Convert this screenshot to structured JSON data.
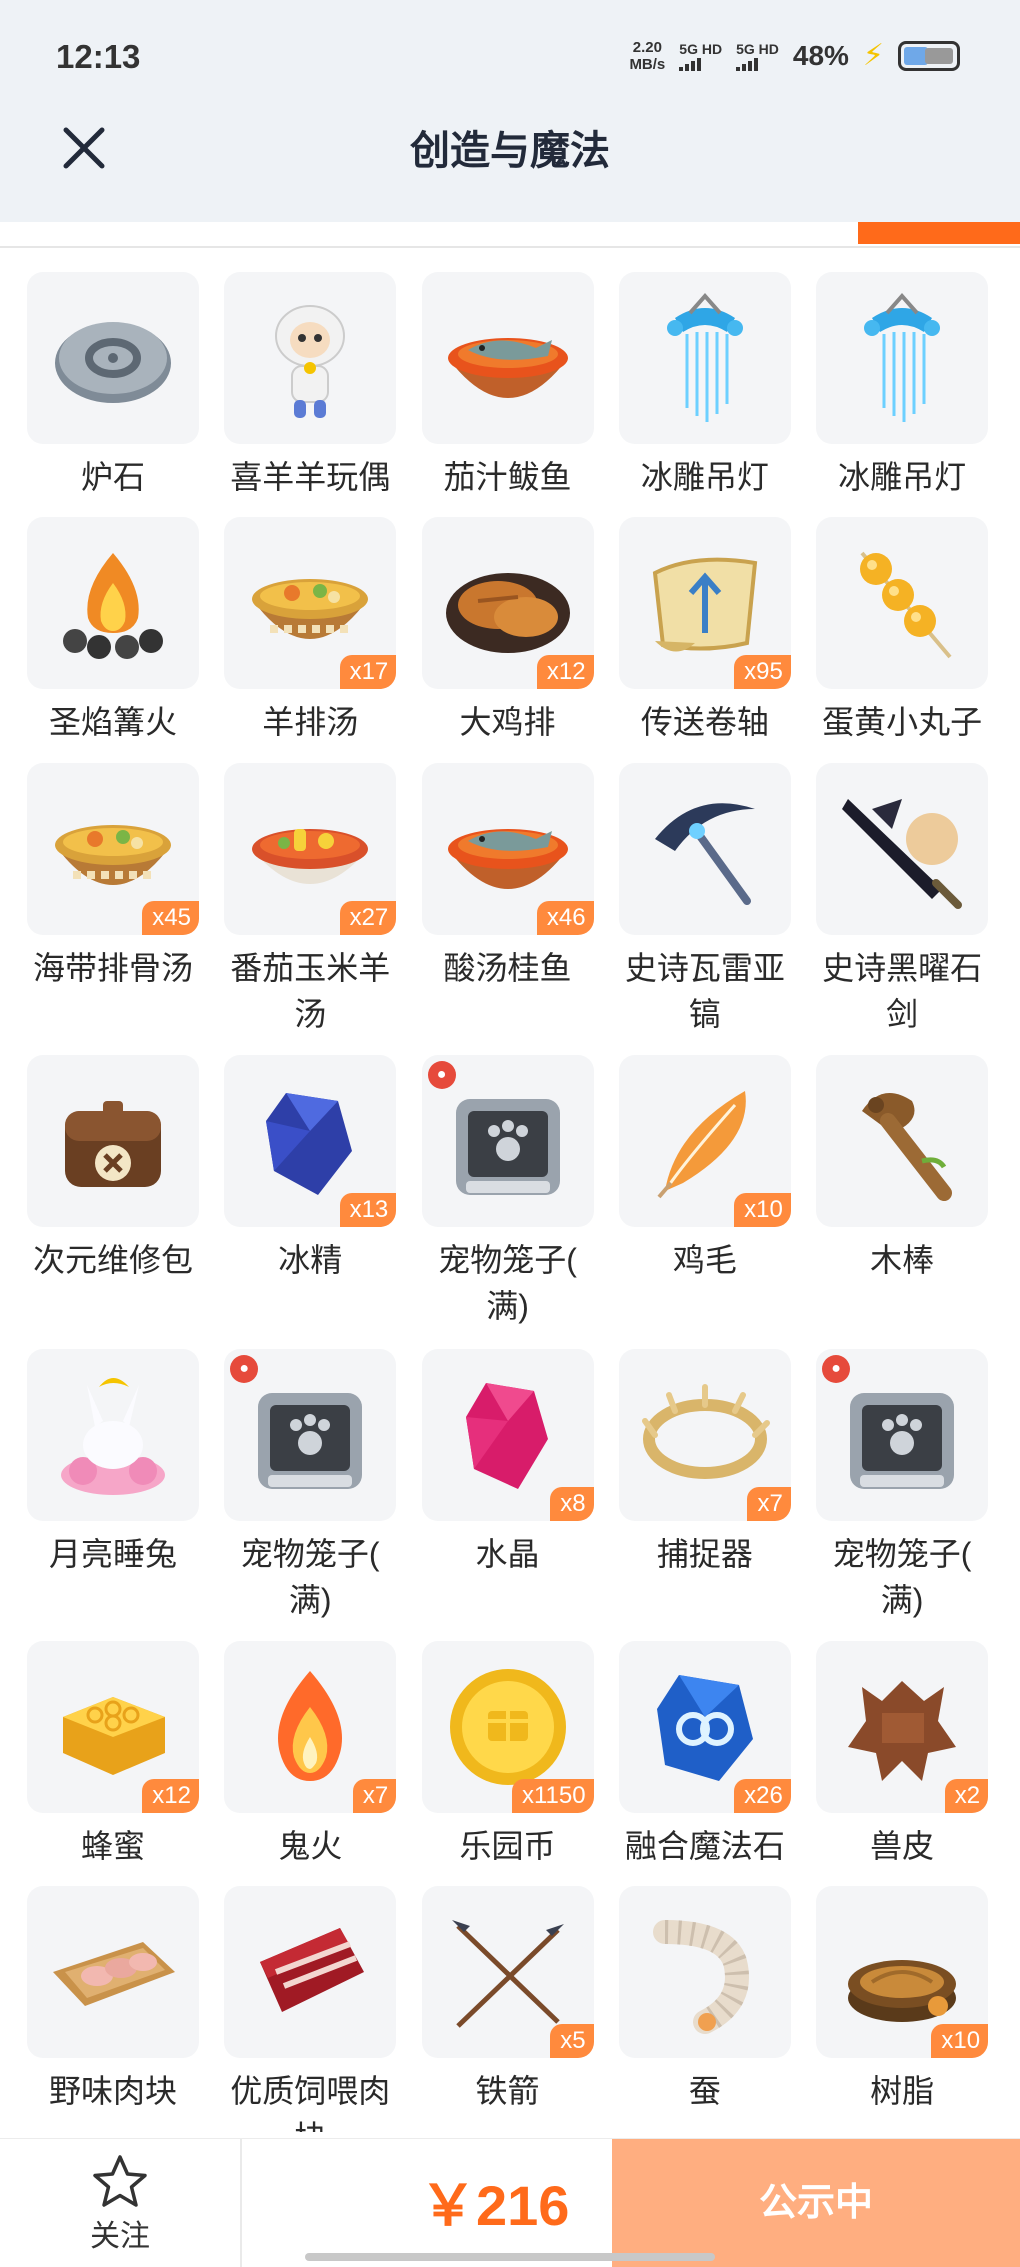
{
  "status_bar": {
    "time": "12:13",
    "net_speed_value": "2.20",
    "net_speed_unit": "MB/s",
    "signal1": "5G HD",
    "signal2": "5G HD",
    "battery": "48%"
  },
  "header": {
    "title": "创造与魔法",
    "close_icon": "close-icon"
  },
  "colors": {
    "accent": "#ff6a1a",
    "badge": "#ff8a3d",
    "button_disabled": "#ffae80",
    "header_bg": "#eef2f6"
  },
  "items": [
    {
      "name": "炉石",
      "qty": "",
      "pet": false,
      "icon": "stone"
    },
    {
      "name": "喜羊羊玩偶",
      "qty": "",
      "pet": false,
      "icon": "sheep"
    },
    {
      "name": "茄汁鲅鱼",
      "qty": "",
      "pet": false,
      "icon": "bowl-fish"
    },
    {
      "name": "冰雕吊灯",
      "qty": "",
      "pet": false,
      "icon": "ice-lamp"
    },
    {
      "name": "冰雕吊灯",
      "qty": "",
      "pet": false,
      "icon": "ice-lamp"
    },
    {
      "name": "圣焰篝火",
      "qty": "",
      "pet": false,
      "icon": "campfire"
    },
    {
      "name": "羊排汤",
      "qty": "x17",
      "pet": false,
      "icon": "soup"
    },
    {
      "name": "大鸡排",
      "qty": "x12",
      "pet": false,
      "icon": "chicken"
    },
    {
      "name": "传送卷轴",
      "qty": "x95",
      "pet": false,
      "icon": "scroll"
    },
    {
      "name": "蛋黄小丸子",
      "qty": "",
      "pet": false,
      "icon": "skewer"
    },
    {
      "name": "海带排骨汤",
      "qty": "x45",
      "pet": false,
      "icon": "soup"
    },
    {
      "name": "番茄玉米羊汤",
      "qty": "x27",
      "pet": false,
      "icon": "soup-red"
    },
    {
      "name": "酸汤桂鱼",
      "qty": "x46",
      "pet": false,
      "icon": "bowl-fish"
    },
    {
      "name": "史诗瓦雷亚镐",
      "qty": "",
      "pet": false,
      "icon": "pickaxe"
    },
    {
      "name": "史诗黑曜石剑",
      "qty": "",
      "pet": false,
      "icon": "sword"
    },
    {
      "name": "次元维修包",
      "qty": "",
      "pet": false,
      "icon": "bag"
    },
    {
      "name": "冰精",
      "qty": "x13",
      "pet": false,
      "icon": "crystal-blue"
    },
    {
      "name": "宠物笼子(满)",
      "qty": "",
      "pet": true,
      "icon": "cage"
    },
    {
      "name": "鸡毛",
      "qty": "x10",
      "pet": false,
      "icon": "feather"
    },
    {
      "name": "木棒",
      "qty": "",
      "pet": false,
      "icon": "club"
    },
    {
      "name": "月亮睡兔",
      "qty": "",
      "pet": false,
      "icon": "rabbit"
    },
    {
      "name": "宠物笼子(满)",
      "qty": "",
      "pet": true,
      "icon": "cage"
    },
    {
      "name": "水晶",
      "qty": "x8",
      "pet": false,
      "icon": "crystal-pink"
    },
    {
      "name": "捕捉器",
      "qty": "x7",
      "pet": false,
      "icon": "ring"
    },
    {
      "name": "宠物笼子(满)",
      "qty": "",
      "pet": true,
      "icon": "cage"
    },
    {
      "name": "蜂蜜",
      "qty": "x12",
      "pet": false,
      "icon": "honey"
    },
    {
      "name": "鬼火",
      "qty": "x7",
      "pet": false,
      "icon": "fire"
    },
    {
      "name": "乐园币",
      "qty": "x1150",
      "pet": false,
      "icon": "coin"
    },
    {
      "name": "融合魔法石",
      "qty": "x26",
      "pet": false,
      "icon": "magic-stone"
    },
    {
      "name": "兽皮",
      "qty": "x2",
      "pet": false,
      "icon": "hide"
    },
    {
      "name": "野味肉块",
      "qty": "",
      "pet": false,
      "icon": "meat-tray"
    },
    {
      "name": "优质饲喂肉块",
      "qty": "",
      "pet": false,
      "icon": "meat"
    },
    {
      "name": "铁箭",
      "qty": "x5",
      "pet": false,
      "icon": "arrows"
    },
    {
      "name": "蚕",
      "qty": "",
      "pet": false,
      "icon": "silkworm"
    },
    {
      "name": "树脂",
      "qty": "x10",
      "pet": false,
      "icon": "resin"
    }
  ],
  "bottom": {
    "follow_label": "关注",
    "price": "￥216",
    "status_button": "公示中"
  }
}
